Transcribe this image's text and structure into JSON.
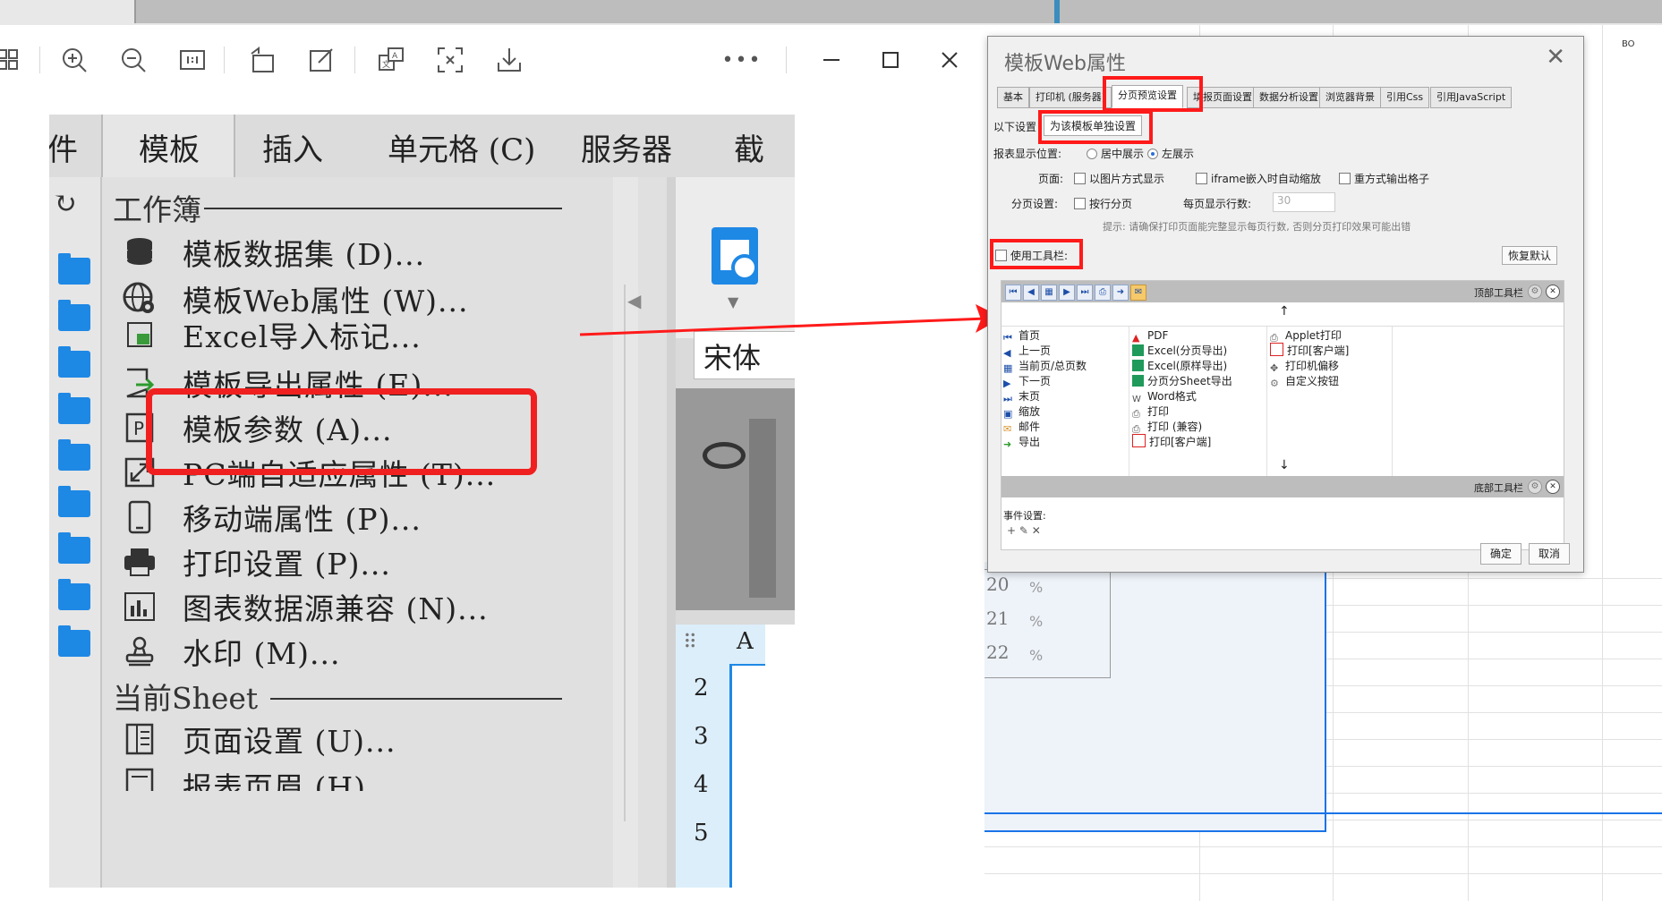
{
  "viewer": {
    "icons": [
      "grid-icon",
      "zoom-in-icon",
      "zoom-out-icon",
      "actual-size-icon",
      "rotate-icon",
      "edit-icon",
      "translate-icon",
      "crop-icon",
      "download-icon",
      "more-icon",
      "minimize-icon",
      "maximize-icon",
      "close-icon"
    ]
  },
  "menu": {
    "tabs": [
      "件",
      "模板",
      "插入",
      "单元格 (C)",
      "服务器",
      "截"
    ],
    "section_workbook": "工作簿",
    "section_sheet": "当前Sheet",
    "items": [
      {
        "label": "模板数据集 (D)..."
      },
      {
        "label": "模板Web属性 (W)..."
      },
      {
        "label": "Excel导入标记..."
      },
      {
        "label": "模板导出属性 (E)..."
      },
      {
        "label": "模板参数 (A)..."
      },
      {
        "label": "PC端自适应属性 (T)..."
      },
      {
        "label": "移动端属性 (P)..."
      },
      {
        "label": "打印设置 (P)..."
      },
      {
        "label": "图表数据源兼容 (N)..."
      },
      {
        "label": "水印 (M)..."
      },
      {
        "label": "页面设置 (U)..."
      },
      {
        "label": "报表页眉 (H)..."
      }
    ],
    "font_box": "宋体",
    "col_a": "A",
    "row_numbers": [
      "2",
      "3",
      "4",
      "5"
    ]
  },
  "dialog": {
    "title": "模板Web属性",
    "tabs": [
      "基本",
      "打印机 (服务器)",
      "分页预览设置",
      "填报页面设置",
      "数据分析设置",
      "浏览器背景",
      "引用Css",
      "引用JavaScript"
    ],
    "scope_prefix": "以下设置",
    "scope_select": "为该模板单独设置",
    "display_label": "报表显示位置:",
    "display_center": "居中展示",
    "display_left": "左展示",
    "page_label": "页面:",
    "opt_image": "以图片方式显示",
    "opt_iframe": "iframe嵌入时自动缩放",
    "opt_redraw": "重方式输出格子",
    "paging_label": "分页设置:",
    "opt_row_paging": "按行分页",
    "rows_per_page_label": "每页显示行数:",
    "rows_per_page_value": "30",
    "hint": "提示: 请确保打印页面能完整显示每页行数, 否则分页打印效果可能出错",
    "use_toolbar": "使用工具栏:",
    "restore_default": "恢复默认",
    "top_toolbar": "顶部工具栏",
    "bottom_toolbar": "底部工具栏",
    "up_arrow": "↑",
    "down_arrow": "↓",
    "col1": [
      "首页",
      "上一页",
      "当前页/总页数",
      "下一页",
      "末页",
      "缩放",
      "邮件",
      "导出"
    ],
    "col2": [
      "PDF",
      "Excel(分页导出)",
      "Excel(原样导出)",
      "分页分Sheet导出",
      "Word格式",
      "打印",
      "打印 (兼容)",
      "打印[客户端]"
    ],
    "col3": [
      "Applet打印",
      "打印[客户端]",
      "打印机偏移",
      "自定义按钮"
    ],
    "event_label": "事件设置:",
    "ok": "确定",
    "cancel": "取消"
  },
  "sheet_bg": {
    "col_label": "BO",
    "rows": [
      "20",
      "21",
      "22"
    ],
    "percent": "%"
  },
  "colors": {
    "highlight_red": "#f02020",
    "folder_blue": "#1e88e5",
    "selection_blue": "#1a73e8"
  }
}
